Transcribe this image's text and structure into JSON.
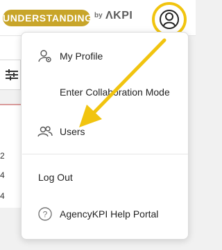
{
  "header": {
    "brand_pill": "UNDERSTANDING",
    "brand_by": "by",
    "brand_kpi": "ΛKPI"
  },
  "background": {
    "row_numbers": [
      "2",
      "4",
      "4"
    ]
  },
  "menu": {
    "items": [
      {
        "label": "My Profile",
        "icon": "user-gear-icon"
      },
      {
        "label": "Enter Collaboration Mode",
        "icon": ""
      },
      {
        "label": "Users",
        "icon": "users-icon"
      },
      {
        "label": "Log Out",
        "icon": ""
      },
      {
        "label": "AgencyKPI Help Portal",
        "icon": "help-circle-icon"
      }
    ]
  },
  "colors": {
    "brand_gold": "#c8a52a",
    "highlight_yellow": "#f1c40f"
  }
}
